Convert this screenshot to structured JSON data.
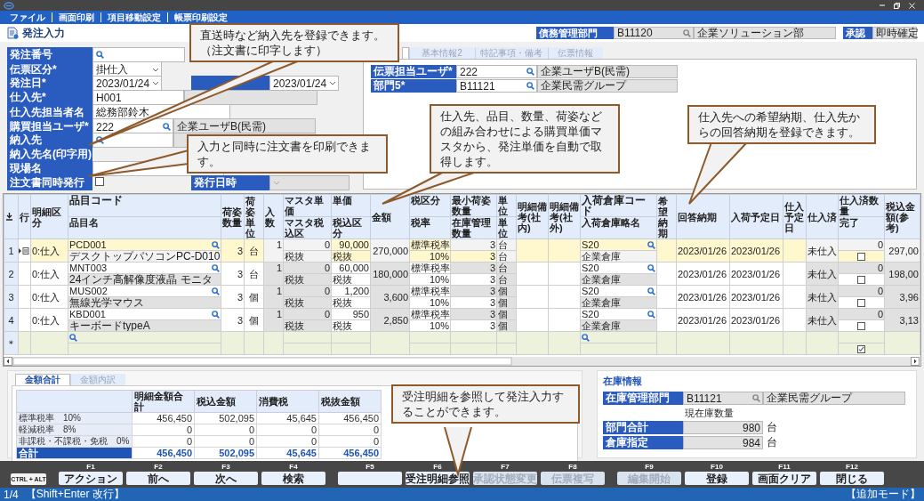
{
  "window": {
    "menu": [
      "ファイル",
      "画面印刷",
      "項目移動設定",
      "帳票印刷設定"
    ]
  },
  "page_title": "発注入力",
  "header": {
    "dept": {
      "label": "債務管理部門",
      "code": "B11120",
      "name": "企業ソリューション部"
    },
    "approval": {
      "label": "承認",
      "value": "即時確定"
    }
  },
  "form": {
    "rows": [
      {
        "label": "発注番号",
        "kind": "search"
      },
      {
        "label": "伝票区分*",
        "kind": "select",
        "value": "掛仕入"
      },
      {
        "label": "発注日*",
        "kind": "select",
        "value": "2023/01/24",
        "extra": {
          "kind": "select",
          "value": "2023/01/24",
          "disabled": false
        }
      },
      {
        "label": "仕入先*",
        "kind": "code_name",
        "value": "H001"
      },
      {
        "label": "仕入先担当者名",
        "kind": "text",
        "value": "総務部鈴木"
      },
      {
        "label": "購買担当ユーザ*",
        "kind": "search_name",
        "value": "222",
        "name": "企業ユーザB(民需)"
      },
      {
        "label": "納入先",
        "kind": "search_name"
      },
      {
        "label": "納入先名(印字用)",
        "kind": "label_only"
      },
      {
        "label": "現場名",
        "kind": "text"
      },
      {
        "label": "注文書同時発行",
        "kind": "checkbox",
        "checked": false,
        "extra": {
          "label": "発行日時",
          "kind": "select",
          "disabled": true
        }
      }
    ]
  },
  "right_panel": {
    "tabs": [
      {
        "selected": true
      },
      {
        "label": "基本情報2",
        "selected": false
      },
      {
        "label": "特記事項・備考",
        "selected": false
      },
      {
        "label": "伝票情報",
        "selected": false
      }
    ],
    "fields": [
      {
        "label": "伝票担当ユーザ*",
        "code": "222",
        "name": "企業ユーザB(民需)"
      },
      {
        "label": "部門5*",
        "code": "B11121",
        "name": "企業民需グループ"
      }
    ]
  },
  "table": {
    "columns": [
      {
        "label": "行"
      },
      {
        "label": "明細区分"
      },
      {
        "top": "品目コード",
        "bottom": "品目名"
      },
      {
        "label": "荷姿数量"
      },
      {
        "label": "荷姿単位"
      },
      {
        "label": "入数"
      },
      {
        "top": "マスタ単価",
        "bottom": "マスタ税込区"
      },
      {
        "top": "単価",
        "bottom": "税込区分"
      },
      {
        "label": "金額"
      },
      {
        "top": "税区分",
        "bottom": "税率"
      },
      {
        "top": "最小荷姿数量",
        "bottom": "在庫管理数量"
      },
      {
        "top": "単位",
        "bottom": "単位"
      },
      {
        "label": "明細備考(社内)"
      },
      {
        "label": "明細備考(社外)"
      },
      {
        "top": "入荷倉庫コード",
        "bottom": "入荷倉庫略名"
      },
      {
        "label": "希望納期"
      },
      {
        "label": "回答納期"
      },
      {
        "label": "入荷予定日"
      },
      {
        "label": "仕入予定日"
      },
      {
        "label": "仕入済"
      },
      {
        "top": "仕入済数量",
        "bottom": "完了"
      },
      {
        "label": "税込金額(参考)"
      }
    ],
    "rows": [
      {
        "kind": "item",
        "no": "1",
        "selected": true,
        "current": true,
        "type": "0:仕入",
        "item_code": "PCD001",
        "item_name": "デスクトップパソコンPC-D010",
        "pack_qty": "3",
        "pack_unit": "台",
        "per_pack": "1",
        "master_price": "0",
        "master_tax": "税抜",
        "price": "90,000",
        "tax_incl": "税抜",
        "amount": "270,000",
        "tax_class": "標準税率",
        "tax_rate": "10%",
        "min_qty": "3",
        "stock_qty": "3",
        "unit_1": "台",
        "unit_2": "台",
        "warehouse_code": "S20",
        "warehouse_name": "企業倉庫",
        "reply_date": "2023/01/26",
        "arrival_date": "2023/01/26",
        "status": "未仕入",
        "received_qty": "0",
        "done": false,
        "tax_incl_amount": "297,00"
      },
      {
        "kind": "item",
        "no": "2",
        "selected": false,
        "current": false,
        "type": "0:仕入",
        "item_code": "MNT003",
        "item_name": "24インチ高解像度液晶 モニタ",
        "pack_qty": "3",
        "pack_unit": "台",
        "per_pack": "1",
        "master_price": "0",
        "master_tax": "税抜",
        "price": "60,000",
        "tax_incl": "税抜",
        "amount": "180,000",
        "tax_class": "標準税率",
        "tax_rate": "10%",
        "min_qty": "3",
        "stock_qty": "3",
        "unit_1": "台",
        "unit_2": "台",
        "warehouse_code": "S20",
        "warehouse_name": "企業倉庫",
        "reply_date": "2023/01/26",
        "arrival_date": "2023/01/26",
        "status": "未仕入",
        "received_qty": "0",
        "done": false,
        "tax_incl_amount": "198,00"
      },
      {
        "kind": "item",
        "no": "3",
        "selected": false,
        "current": false,
        "type": "0:仕入",
        "item_code": "MUS002",
        "item_name": "無線光学マウス",
        "pack_qty": "3",
        "pack_unit": "個",
        "per_pack": "1",
        "master_price": "0",
        "master_tax": "税抜",
        "price": "1,200",
        "tax_incl": "税抜",
        "amount": "3,600",
        "tax_class": "標準税率",
        "tax_rate": "10%",
        "min_qty": "3",
        "stock_qty": "3",
        "unit_1": "個",
        "unit_2": "個",
        "warehouse_code": "S20",
        "warehouse_name": "企業倉庫",
        "reply_date": "2023/01/26",
        "arrival_date": "2023/01/26",
        "status": "未仕入",
        "received_qty": "0",
        "done": false,
        "tax_incl_amount": "3,96"
      },
      {
        "kind": "item",
        "no": "4",
        "selected": false,
        "current": false,
        "type": "0:仕入",
        "item_code": "KBD001",
        "item_name": "キーボードtypeA",
        "pack_qty": "3",
        "pack_unit": "個",
        "per_pack": "1",
        "master_price": "0",
        "master_tax": "税抜",
        "price": "950",
        "tax_incl": "税抜",
        "amount": "2,850",
        "tax_class": "標準税率",
        "tax_rate": "10%",
        "min_qty": "3",
        "stock_qty": "3",
        "unit_1": "個",
        "unit_2": "個",
        "warehouse_code": "S20",
        "warehouse_name": "企業倉庫",
        "reply_date": "2023/01/26",
        "arrival_date": "2023/01/26",
        "status": "未仕入",
        "received_qty": "0",
        "done": false,
        "tax_incl_amount": "3,13"
      },
      {
        "kind": "new",
        "no": "＊",
        "selected": false,
        "current": false,
        "done": true
      }
    ]
  },
  "summary": {
    "tabs": [
      {
        "label": "金額合計",
        "selected": true
      },
      {
        "label": "金額内訳",
        "selected": false
      }
    ],
    "columns": [
      "明細金額合計",
      "税込金額",
      "消費税",
      "税抜金額"
    ],
    "rows": [
      {
        "kind": "rate",
        "label": "標準税率　10%",
        "values": [
          "456,450",
          "502,095",
          "45,645",
          "456,450"
        ]
      },
      {
        "kind": "rate",
        "label": "軽減税率　8%",
        "values": [
          "0",
          "0",
          "0",
          "0"
        ]
      },
      {
        "kind": "rate",
        "label": "非課税・不課税・免税　0%",
        "values": [
          "0",
          "0",
          "0",
          "0"
        ]
      },
      {
        "kind": "total",
        "label": "合計",
        "values": [
          "456,450",
          "502,095",
          "45,645",
          "456,450"
        ]
      }
    ]
  },
  "stock": {
    "title": "在庫情報",
    "dept": {
      "label": "在庫管理部門",
      "code": "B11121",
      "name": "企業民需グループ"
    },
    "caption": "現在庫数量",
    "rows": [
      {
        "label": "部門合計",
        "value": "980",
        "unit": "台"
      },
      {
        "label": "倉庫指定",
        "value": "984",
        "unit": "台"
      }
    ]
  },
  "function_keys": {
    "modifier": "CTRL + ALT",
    "keys": [
      {
        "key": "F1",
        "label": "アクション",
        "disabled": false
      },
      {
        "key": "F2",
        "label": "前へ",
        "disabled": false
      },
      {
        "key": "F3",
        "label": "次へ",
        "disabled": false
      },
      {
        "key": "F4",
        "label": "検索",
        "disabled": false
      },
      {
        "key": "F5",
        "disabled": false
      },
      {
        "key": "F6",
        "label": "受注明細参照",
        "disabled": false
      },
      {
        "key": "F7",
        "label": "承認状態変更",
        "disabled": true
      },
      {
        "key": "F8",
        "label": "伝票複写",
        "disabled": true
      },
      {
        "key": "F9",
        "label": "編集開始",
        "disabled": true
      },
      {
        "key": "F10",
        "label": "登録",
        "disabled": false
      },
      {
        "key": "F11",
        "label": "画面クリア",
        "disabled": false
      },
      {
        "key": "F12",
        "label": "閉じる",
        "disabled": false
      }
    ]
  },
  "status_bar": {
    "position": "1/4",
    "hint": "【Shift+Enter 改行】",
    "mode": "【追加モード】"
  },
  "callouts": [
    {
      "text": "直送時など納入先を登録できます。（注文書に印字します）"
    },
    {
      "text": "入力と同時に注文書を印刷できます。"
    },
    {
      "text": "仕入先、品目、数量、荷姿などの組み合わせによる購買単価マスタから、発注単価を自動で取得します。"
    },
    {
      "text": "仕入先への希望納期、仕入先からの回答納期を登録できます。"
    },
    {
      "text": "受注明細を参照して発注入力することができます。"
    }
  ]
}
